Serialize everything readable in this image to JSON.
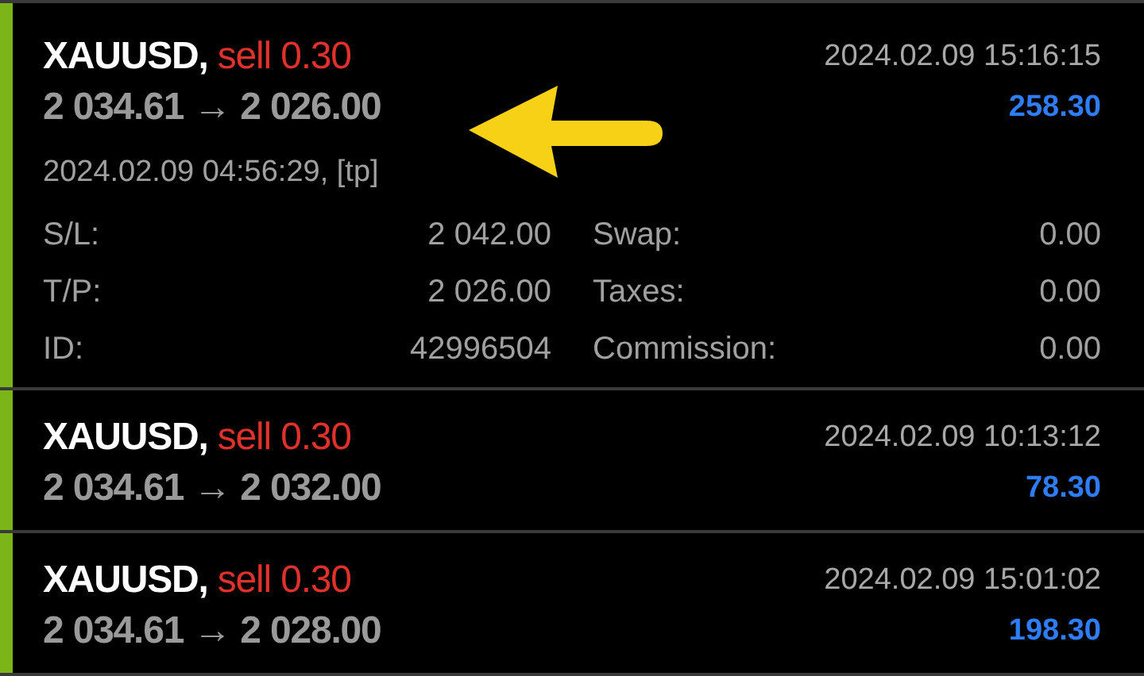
{
  "trades": [
    {
      "symbol": "XAUUSD,",
      "side": "sell",
      "volume": "0.30",
      "prices": "2 034.61 → 2 026.00",
      "time": "2024.02.09 15:16:15",
      "profit": "258.30",
      "expanded": true,
      "open_info": "2024.02.09 04:56:29, [tp]",
      "details_left": [
        {
          "label": "S/L:",
          "value": "2 042.00"
        },
        {
          "label": "T/P:",
          "value": "2 026.00"
        },
        {
          "label": "ID:",
          "value": "42996504"
        }
      ],
      "details_right": [
        {
          "label": "Swap:",
          "value": "0.00"
        },
        {
          "label": "Taxes:",
          "value": "0.00"
        },
        {
          "label": "Commission:",
          "value": "0.00"
        }
      ]
    },
    {
      "symbol": "XAUUSD,",
      "side": "sell",
      "volume": "0.30",
      "prices": "2 034.61 → 2 032.00",
      "time": "2024.02.09 10:13:12",
      "profit": "78.30",
      "expanded": false
    },
    {
      "symbol": "XAUUSD,",
      "side": "sell",
      "volume": "0.30",
      "prices": "2 034.61 → 2 028.00",
      "time": "2024.02.09 15:01:02",
      "profit": "198.30",
      "expanded": false
    }
  ]
}
